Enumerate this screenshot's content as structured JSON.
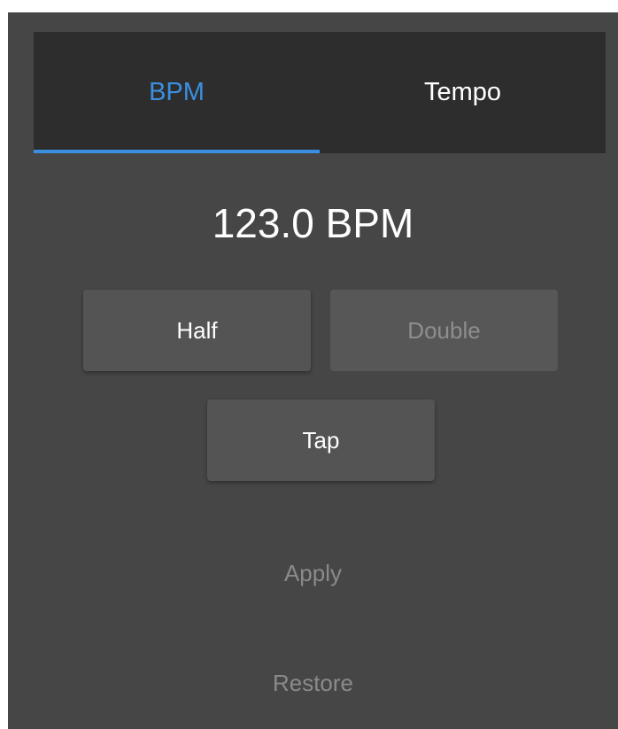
{
  "tabs": {
    "bpm_label": "BPM",
    "tempo_label": "Tempo",
    "active": "BPM",
    "active_color": "#3b8fe0"
  },
  "bpm_display": {
    "value": "123.0 BPM"
  },
  "controls": {
    "half_label": "Half",
    "double_label": "Double",
    "tap_label": "Tap",
    "apply_label": "Apply",
    "restore_label": "Restore"
  },
  "colors": {
    "background": "#464646",
    "tabbar": "#2d2d2d",
    "accent": "#3b8fe0"
  }
}
